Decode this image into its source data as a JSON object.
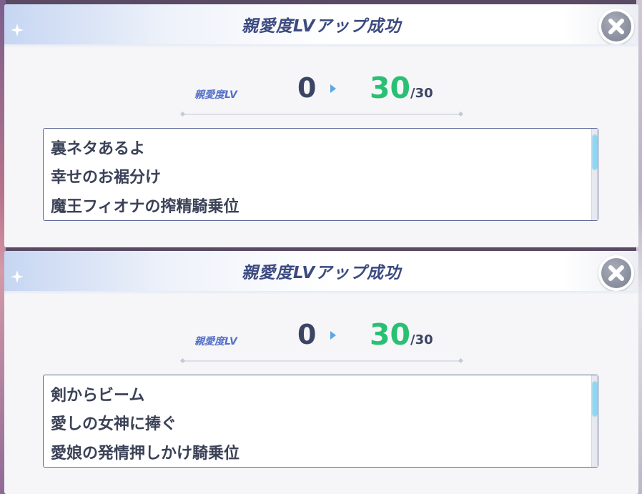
{
  "dialogs": [
    {
      "title": "親愛度LVアップ成功",
      "lv_label": "親愛度LV",
      "lv_from": "0",
      "lv_to": "30",
      "lv_max": "/30",
      "items": [
        "裏ネタあるよ",
        "幸せのお裾分け",
        "魔王フィオナの搾精騎乗位"
      ]
    },
    {
      "title": "親愛度LVアップ成功",
      "lv_label": "親愛度LV",
      "lv_from": "0",
      "lv_to": "30",
      "lv_max": "/30",
      "items": [
        "剣からビーム",
        "愛しの女神に捧ぐ",
        "愛娘の発情押しかけ騎乗位"
      ]
    }
  ],
  "icons": {
    "close": "close-icon",
    "arrow": "arrow-right-icon",
    "sparkle": "sparkle-icon"
  },
  "colors": {
    "title": "#3c4a80",
    "lv_label": "#5570c8",
    "lv_to": "#29c073",
    "lv_from": "#3b4563",
    "scroll_thumb": "#8ed7f4"
  }
}
